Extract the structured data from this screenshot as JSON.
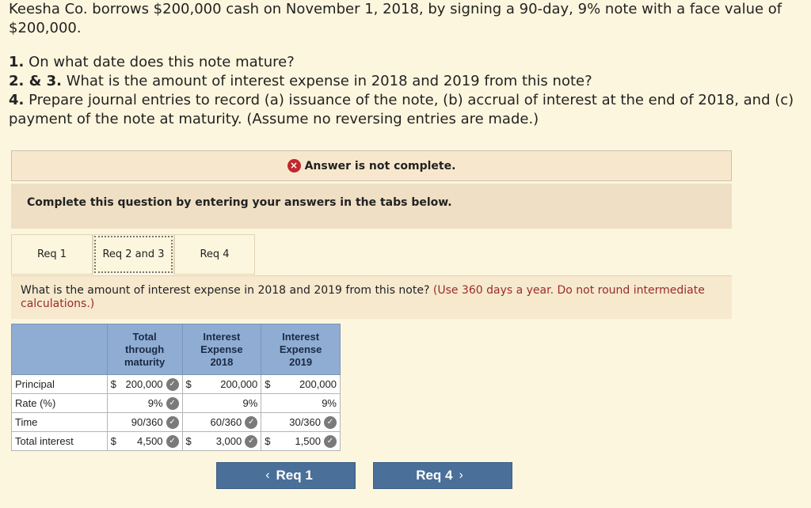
{
  "problem": {
    "statement": "Keesha Co. borrows $200,000 cash on November 1, 2018, by signing a 90-day, 9% note with a face value of $200,000.",
    "items": [
      {
        "num": "1.",
        "text": " On what date does this note mature?"
      },
      {
        "num": "2. & 3.",
        "text": " What is the amount of interest expense in 2018 and 2019 from this note?"
      },
      {
        "num": "4.",
        "text": " Prepare journal entries to record (a) issuance of the note, (b) accrual of interest at the end of 2018, and (c) payment of the note at maturity. (Assume no reversing entries are made.)"
      }
    ]
  },
  "banner": {
    "icon": "x-circle-icon",
    "text": "Answer is not complete."
  },
  "instruction": "Complete this question by entering your answers in the tabs below.",
  "tabs": [
    {
      "label": "Req 1"
    },
    {
      "label": "Req 2 and 3"
    },
    {
      "label": "Req 4"
    }
  ],
  "active_tab": "Req 2 and 3",
  "question": {
    "text": "What is the amount of interest expense in 2018 and 2019 from this note? ",
    "hint": "(Use 360 days a year. Do not round intermediate calculations.)"
  },
  "table": {
    "headers": [
      "",
      "Total\nthrough\nmaturity",
      "Interest\nExpense\n2018",
      "Interest\nExpense\n2019"
    ],
    "rows": [
      {
        "label": "Principal",
        "cells": [
          {
            "dollar": "$",
            "value": "200,000",
            "check": true
          },
          {
            "dollar": "$",
            "value": "200,000",
            "check": false
          },
          {
            "dollar": "$",
            "value": "200,000",
            "check": false
          }
        ]
      },
      {
        "label": "Rate (%)",
        "cells": [
          {
            "dollar": "",
            "value": "9%",
            "check": true
          },
          {
            "dollar": "",
            "value": "9%",
            "check": false
          },
          {
            "dollar": "",
            "value": "9%",
            "check": false
          }
        ]
      },
      {
        "label": "Time",
        "cells": [
          {
            "dollar": "",
            "value": "90/360",
            "check": true
          },
          {
            "dollar": "",
            "value": "60/360",
            "check": true
          },
          {
            "dollar": "",
            "value": "30/360",
            "check": true
          }
        ]
      },
      {
        "label": "Total interest",
        "cells": [
          {
            "dollar": "$",
            "value": "4,500",
            "check": true
          },
          {
            "dollar": "$",
            "value": "3,000",
            "check": true
          },
          {
            "dollar": "$",
            "value": "1,500",
            "check": true
          }
        ]
      }
    ]
  },
  "nav": {
    "prev_label": "Req 1",
    "next_label": "Req 4",
    "prev_arrow": "‹",
    "next_arrow": "›"
  }
}
